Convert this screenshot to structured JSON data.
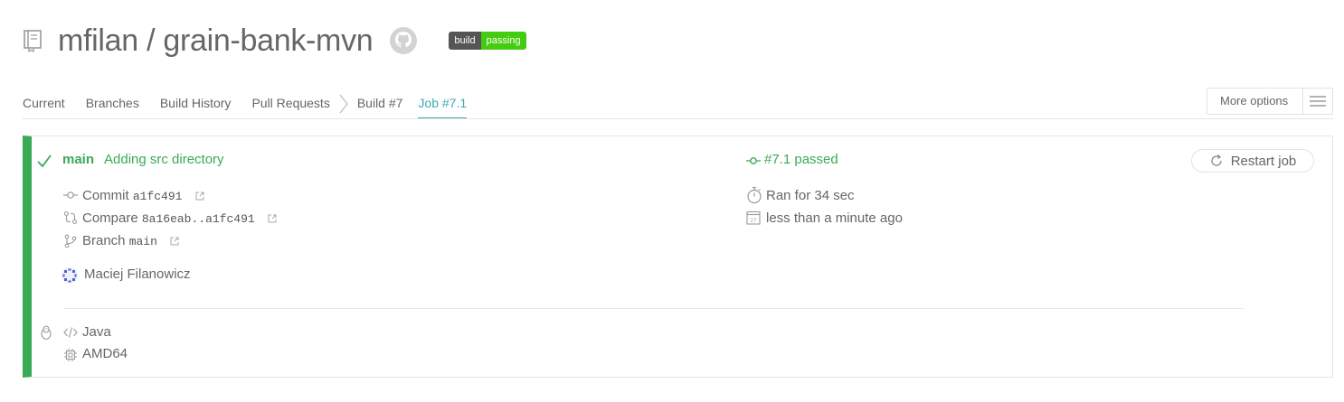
{
  "repo": {
    "owner": "mfilan",
    "separator": "/",
    "name": "grain-bank-mvn",
    "badge_left": "build",
    "badge_right": "passing"
  },
  "tabs": [
    {
      "label": "Current"
    },
    {
      "label": "Branches"
    },
    {
      "label": "Build History"
    },
    {
      "label": "Pull Requests"
    },
    {
      "label": "Build #7"
    },
    {
      "label": "Job #7.1",
      "active": true
    }
  ],
  "more_options": {
    "label": "More options"
  },
  "job": {
    "branch": "main",
    "message": "Adding src directory",
    "job_status": "#7.1 passed",
    "restart_label": "Restart job",
    "commit_label": "Commit",
    "commit_sha": "a1fc491",
    "compare_label": "Compare",
    "compare_range": "8a16eab..a1fc491",
    "branch_label": "Branch",
    "branch_name": "main",
    "author": "Maciej Filanowicz",
    "duration": "Ran for 34 sec",
    "finished": "less than a minute ago",
    "calendar_day": "27",
    "language": "Java",
    "arch": "AMD64"
  },
  "colors": {
    "passed": "#39aa56",
    "active_tab": "#3eaaaf",
    "badge_passing": "#44cc11",
    "badge_label": "#555555"
  }
}
